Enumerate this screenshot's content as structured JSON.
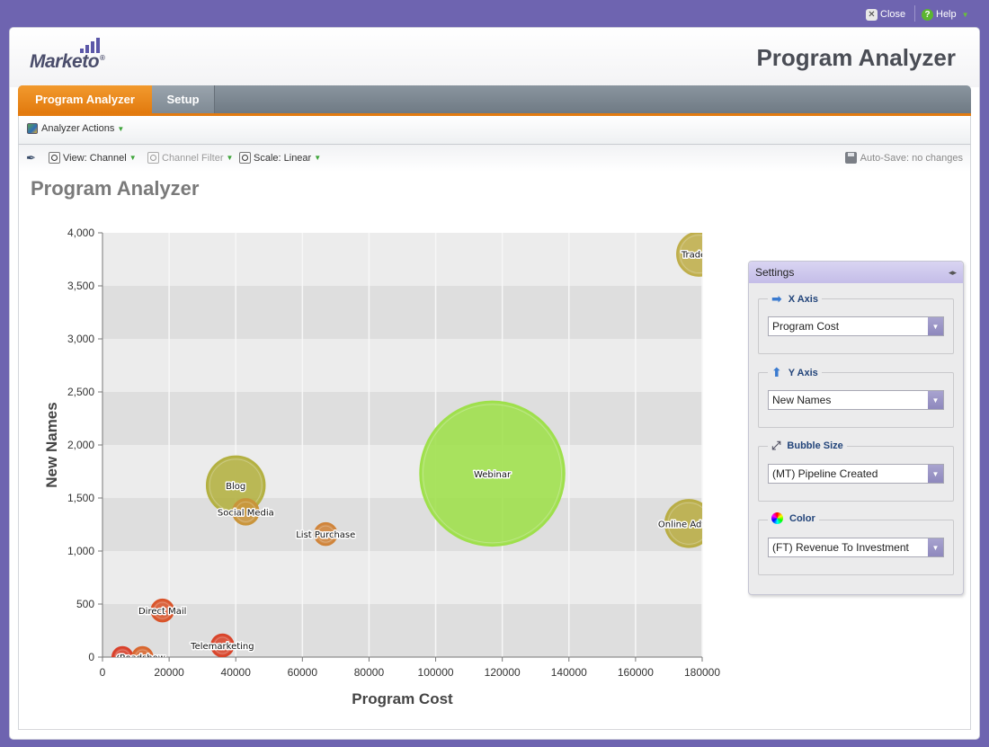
{
  "topbar": {
    "close_label": "Close",
    "help_label": "Help"
  },
  "header": {
    "logo_text": "Marketo",
    "app_title": "Program Analyzer"
  },
  "tabs": [
    {
      "label": "Program Analyzer",
      "active": true
    },
    {
      "label": "Setup",
      "active": false
    }
  ],
  "actions": {
    "analyzer_actions_label": "Analyzer Actions"
  },
  "toolbar": {
    "view_label": "View: Channel",
    "channel_filter_label": "Channel Filter",
    "scale_label": "Scale: Linear",
    "autosave_label": "Auto-Save: no changes"
  },
  "page_title": "Program Analyzer",
  "settings": {
    "title": "Settings",
    "x_axis_label": "X Axis",
    "x_axis_value": "Program Cost",
    "y_axis_label": "Y Axis",
    "y_axis_value": "New Names",
    "bubble_size_label": "Bubble Size",
    "bubble_size_value": "(MT) Pipeline Created",
    "color_label": "Color",
    "color_value": "(FT) Revenue To Investment"
  },
  "chart_data": {
    "type": "scatter",
    "xlabel": "Program Cost",
    "ylabel": "New Names",
    "xlim": [
      0,
      180000
    ],
    "ylim": [
      0,
      4000
    ],
    "x_ticks": [
      0,
      20000,
      40000,
      60000,
      80000,
      100000,
      120000,
      140000,
      160000,
      180000
    ],
    "x_tick_labels": [
      "0",
      "20000",
      "40000",
      "60000",
      "80000",
      "100000",
      "120000",
      "140000",
      "160000",
      "180000"
    ],
    "y_ticks": [
      0,
      500,
      1000,
      1500,
      2000,
      2500,
      3000,
      3500,
      4000
    ],
    "y_tick_labels": [
      "0",
      "500",
      "1,000",
      "1,500",
      "2,000",
      "2,500",
      "3,000",
      "3,500",
      "4,000"
    ],
    "grid": true,
    "points": [
      {
        "label": "Tradesh",
        "x": 179000,
        "y": 3800,
        "size": 24,
        "color": "#bfae4a"
      },
      {
        "label": "Blog",
        "x": 40000,
        "y": 1620,
        "size": 32,
        "color": "#b3b040"
      },
      {
        "label": "Social Media",
        "x": 43000,
        "y": 1370,
        "size": 14,
        "color": "#c9943a"
      },
      {
        "label": "List Purchase",
        "x": 67000,
        "y": 1160,
        "size": 12,
        "color": "#d0843a"
      },
      {
        "label": "Webinar",
        "x": 117000,
        "y": 1730,
        "size": 80,
        "color": "#9ee04a"
      },
      {
        "label": "Online Advert",
        "x": 176000,
        "y": 1260,
        "size": 26,
        "color": "#b9ad44"
      },
      {
        "label": "Direct Mail",
        "x": 18000,
        "y": 440,
        "size": 12,
        "color": "#d9542a"
      },
      {
        "label": "Telemarketing",
        "x": 36000,
        "y": 110,
        "size": 12,
        "color": "#d9442a"
      },
      {
        "label": "Co",
        "x": 6000,
        "y": 0,
        "size": 11,
        "color": "#d9402a"
      },
      {
        "label": "Roadshow",
        "x": 12000,
        "y": 0,
        "size": 11,
        "color": "#d9662e"
      }
    ]
  }
}
